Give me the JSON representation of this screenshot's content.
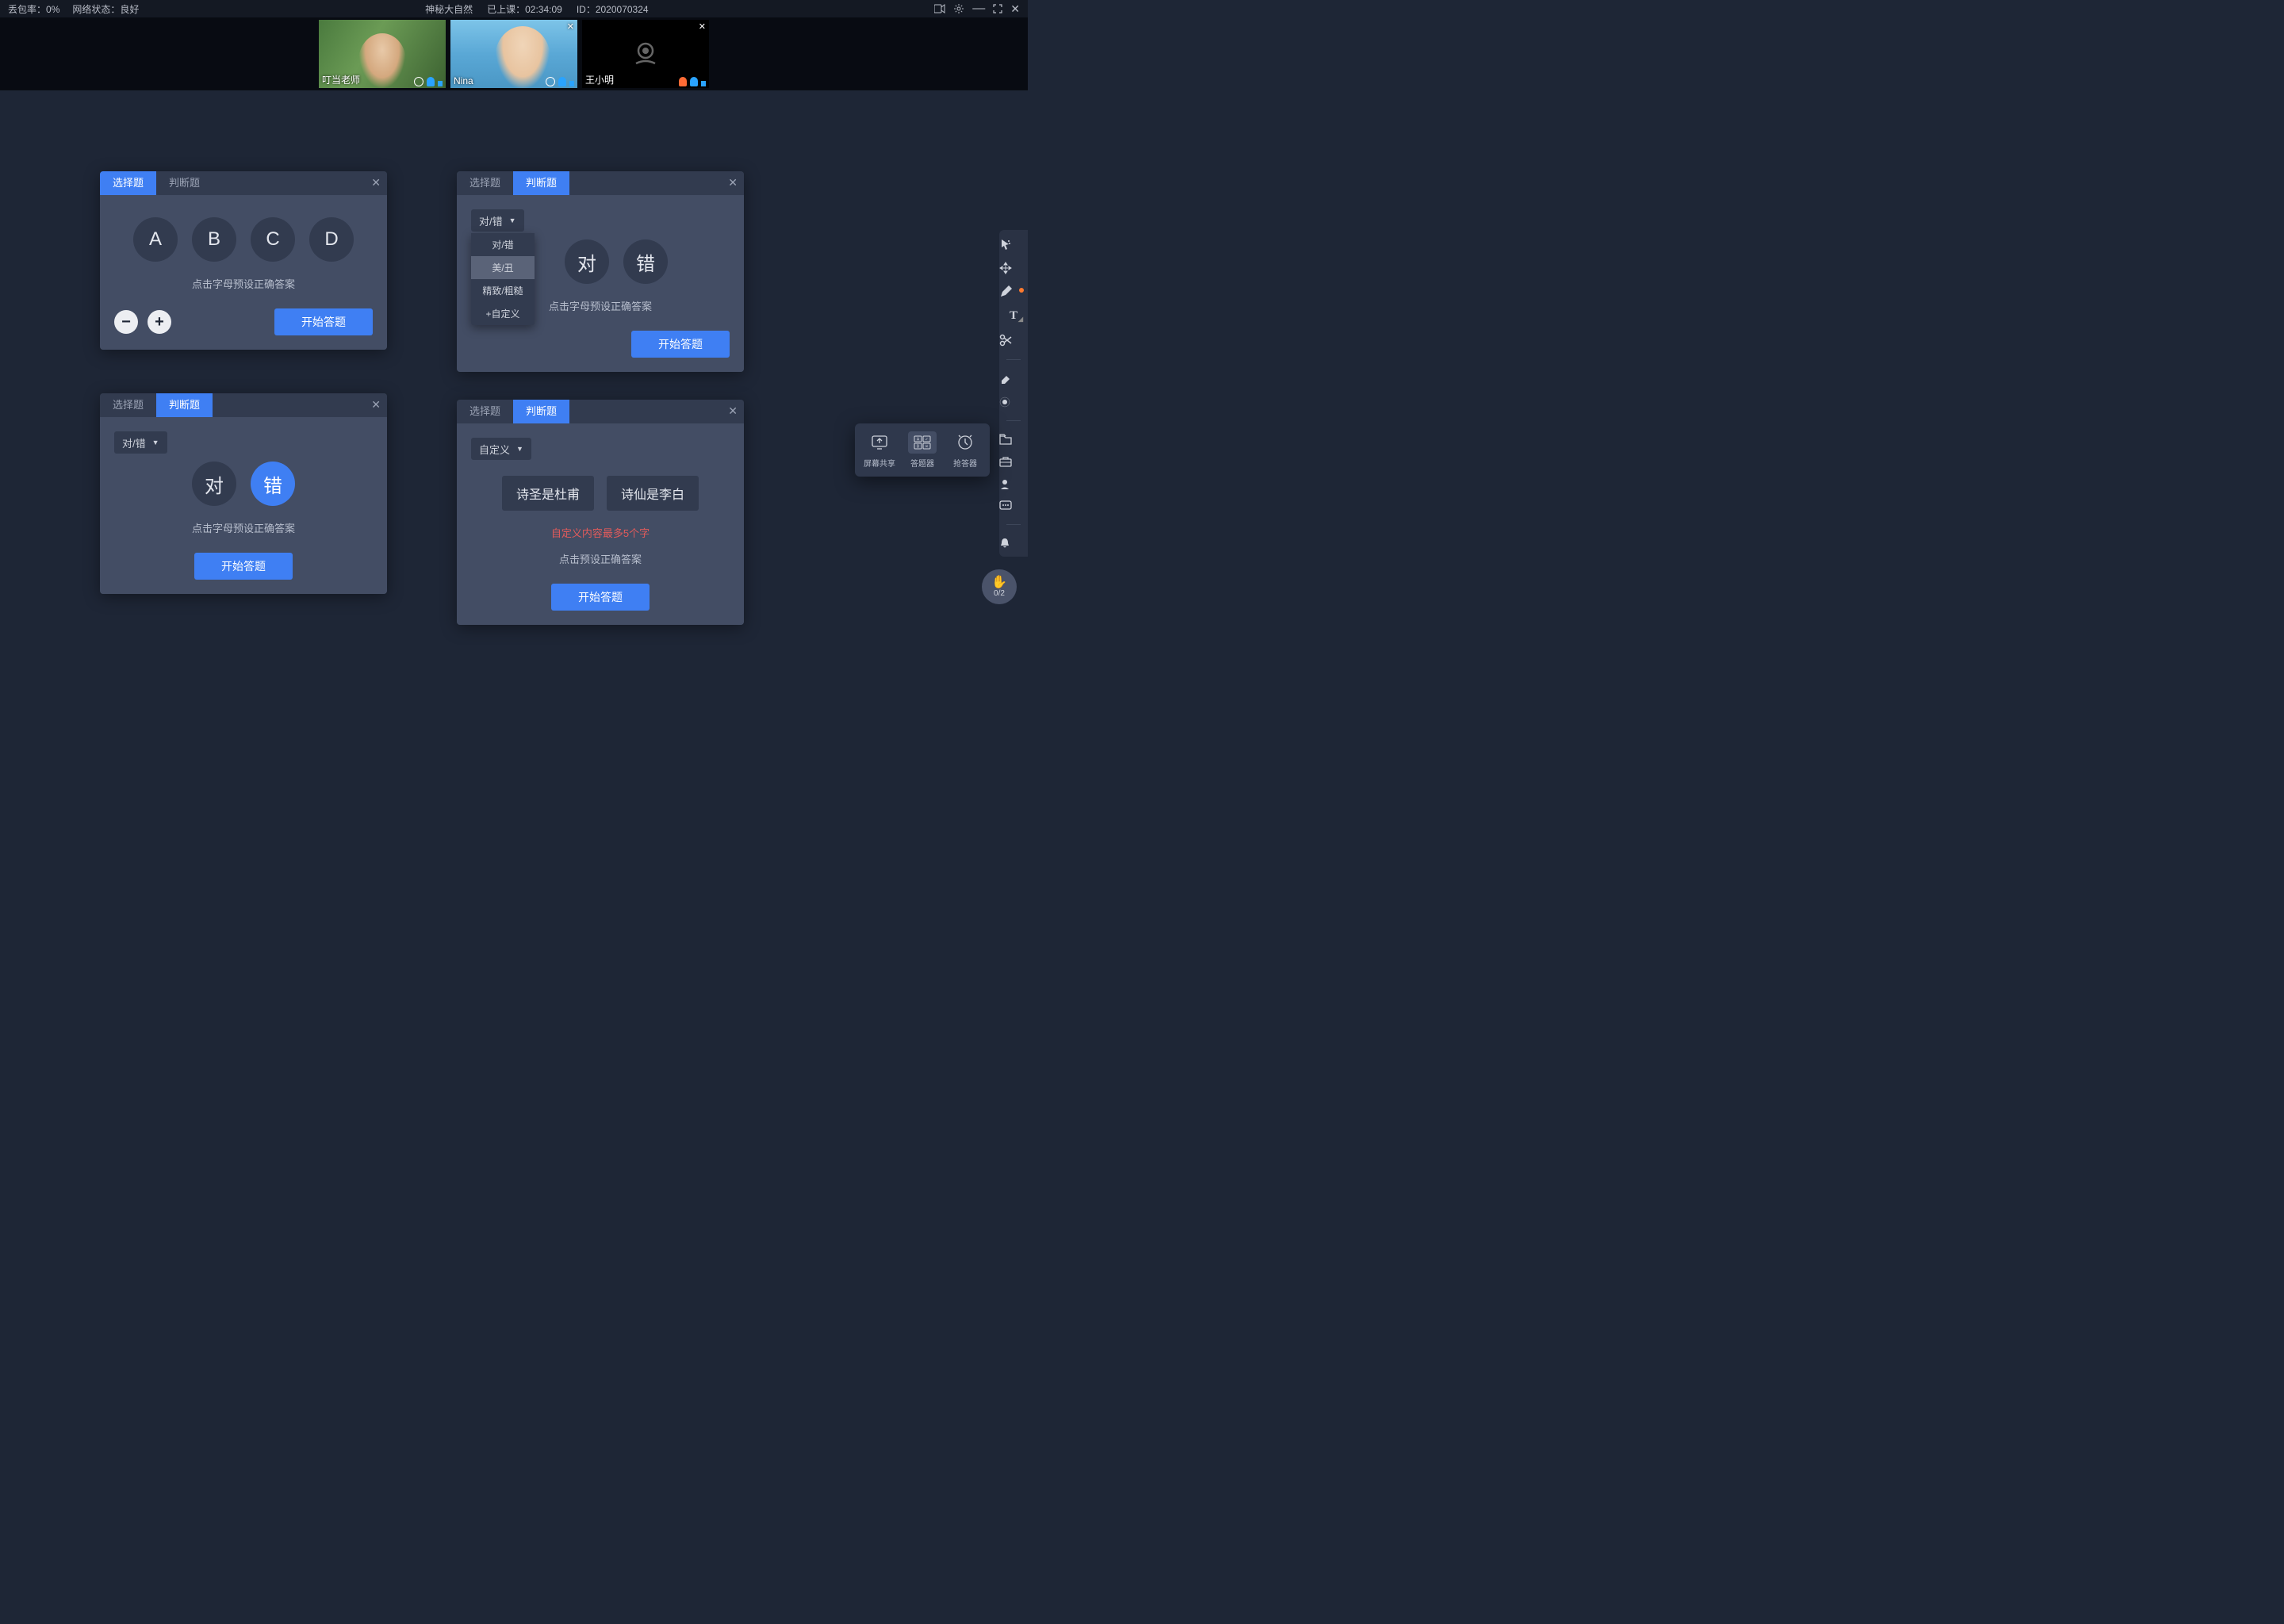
{
  "topbar": {
    "loss_label": "丢包率：",
    "loss_value": "0%",
    "net_label": "网络状态：",
    "net_value": "良好",
    "title": "神秘大自然",
    "elapsed_label": "已上课：",
    "elapsed_value": "02:34:09",
    "id_label": "ID：",
    "id_value": "2020070324"
  },
  "participants": [
    {
      "name": "叮当老师",
      "muted": false,
      "camera": true
    },
    {
      "name": "Nina",
      "muted": false,
      "camera": true
    },
    {
      "name": "王小明",
      "muted": true,
      "camera": false
    }
  ],
  "labels": {
    "tab_choice": "选择题",
    "tab_judge": "判断题",
    "hint_preset": "点击字母预设正确答案",
    "hint_preset2": "点击预设正确答案",
    "start": "开始答题",
    "custom_warn": "自定义内容最多5个字"
  },
  "card1": {
    "options": [
      "A",
      "B",
      "C",
      "D"
    ]
  },
  "card2": {
    "select_value": "对/错",
    "dd": [
      "对/错",
      "美/丑",
      "精致/粗糙",
      "+自定义"
    ],
    "opts": [
      "对",
      "错"
    ]
  },
  "card3": {
    "select_value": "对/错",
    "opts": [
      "对",
      "错"
    ],
    "selected_index": 1
  },
  "card4": {
    "select_value": "自定义",
    "opts": [
      "诗圣是杜甫",
      "诗仙是李白"
    ]
  },
  "popup": {
    "share": "屏幕共享",
    "quiz": "答题器",
    "buzzer": "抢答器"
  },
  "hand": {
    "count": "0/2"
  }
}
